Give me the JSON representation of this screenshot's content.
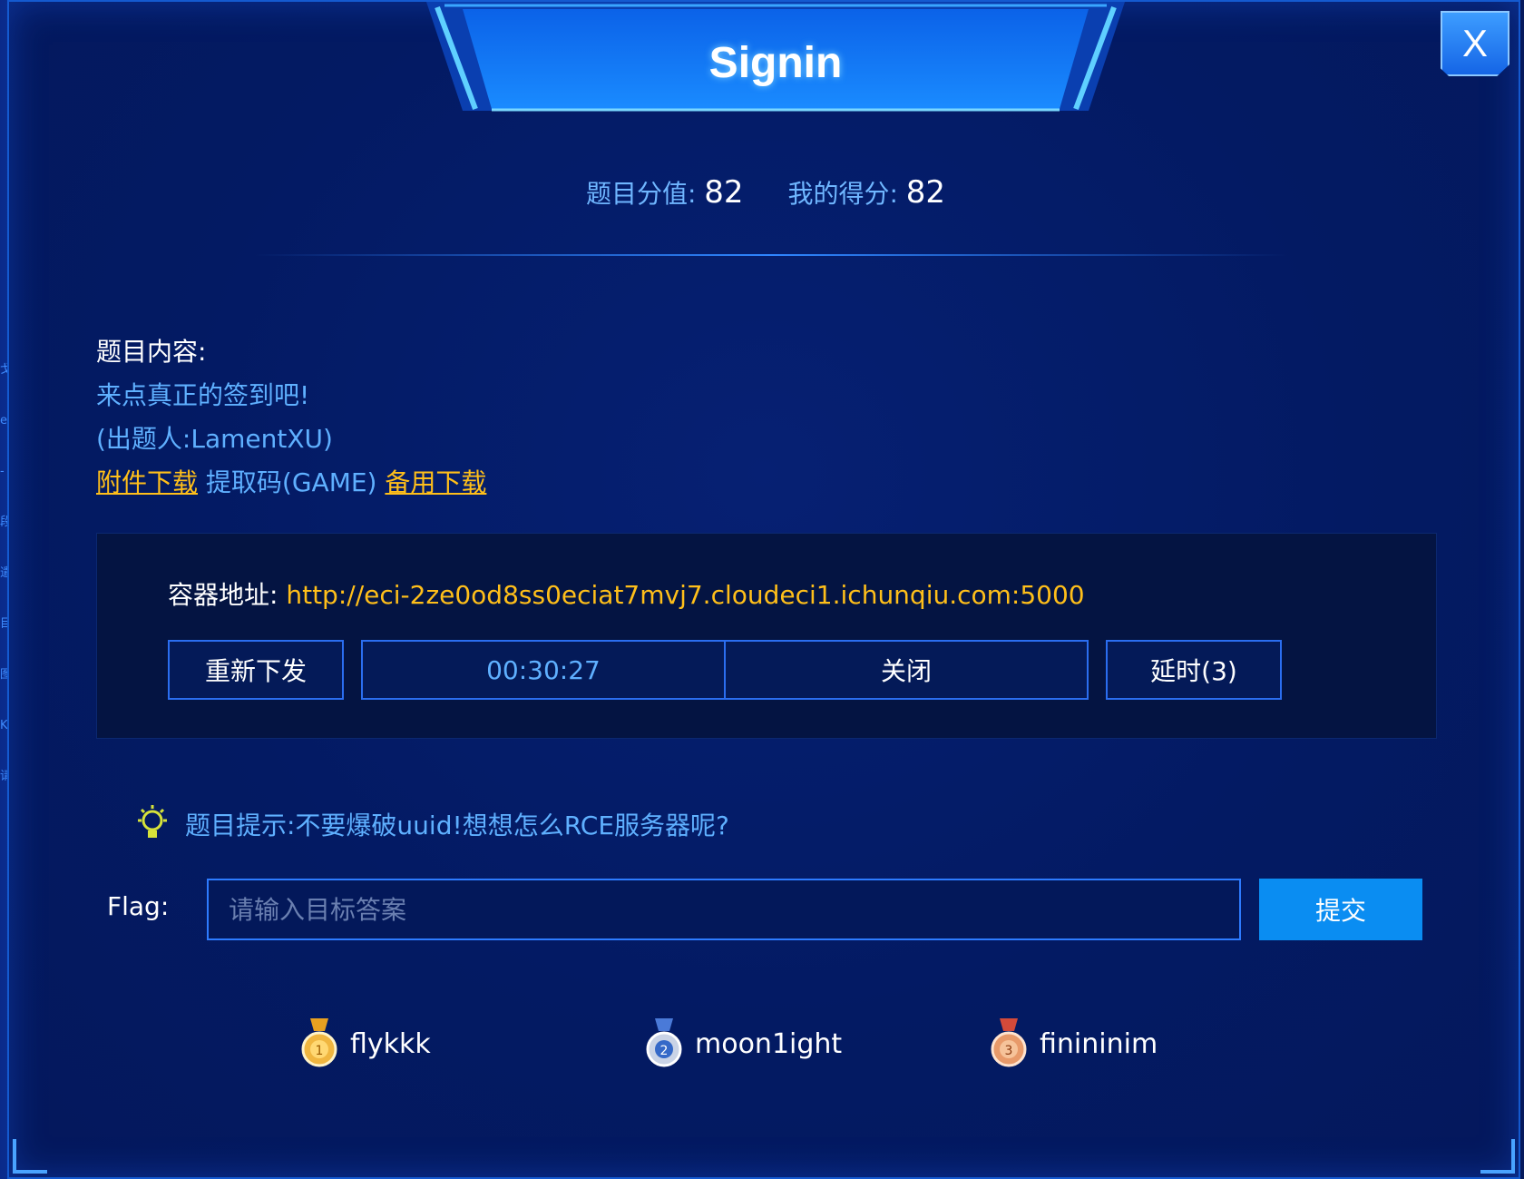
{
  "modal": {
    "title": "Signin",
    "close_label": "X"
  },
  "side_strip_glyphs": [
    "戈",
    "e",
    "-",
    "段",
    "遣",
    "目",
    "图",
    "K",
    "请"
  ],
  "scores": {
    "challenge_score_label": "题目分值:",
    "challenge_score": "82",
    "my_score_label": "我的得分:",
    "my_score": "82"
  },
  "content": {
    "heading": "题目内容:",
    "description": "来点真正的签到吧!",
    "author": "(出题人:LamentXU)",
    "attachment_link": "附件下载",
    "extract_code": "提取码(GAME)",
    "backup_link": "备用下载"
  },
  "container": {
    "address_label": "容器地址:",
    "address_url": "http://eci-2ze0od8ss0eciat7mvj7.cloudeci1.ichunqiu.com:5000",
    "reissue_label": "重新下发",
    "timer": "00:30:27",
    "close_label": "关闭",
    "extend_label": "延时(3)"
  },
  "hint": {
    "icon": "lightbulb-icon",
    "text": "题目提示:不要爆破uuid!想想怎么RCE服务器呢?"
  },
  "flag": {
    "label": "Flag:",
    "placeholder": "请输入目标答案",
    "value": "",
    "submit_label": "提交"
  },
  "solvers": [
    {
      "rank": "1",
      "name": "flykkk",
      "medal_color": "#f0b640"
    },
    {
      "rank": "2",
      "name": "moon1ight",
      "medal_color": "#c9d3e6"
    },
    {
      "rank": "3",
      "name": "finininim",
      "medal_color": "#e89a6a"
    }
  ],
  "colors": {
    "accent": "#0a8df2",
    "link": "#ffbf1a",
    "hint_text": "#5fb0ff",
    "background": "#031a63"
  }
}
